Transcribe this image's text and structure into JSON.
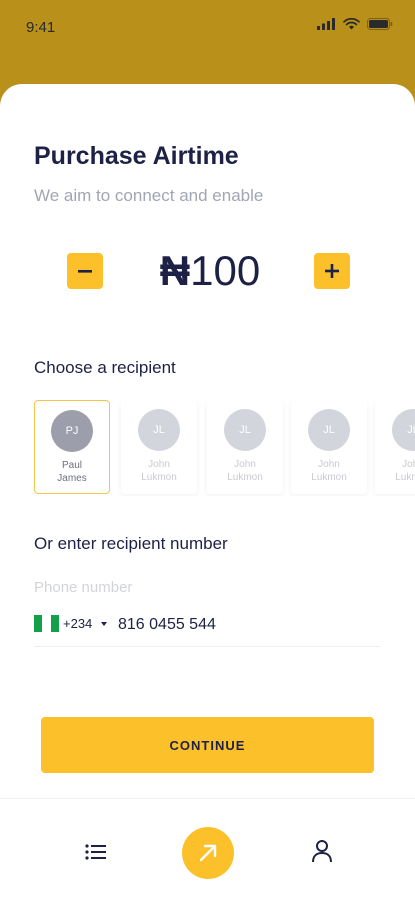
{
  "status_bar": {
    "time": "9:41"
  },
  "page": {
    "title": "Purchase Airtime",
    "subtitle": "We aim to connect and enable"
  },
  "amount": {
    "currency": "₦",
    "value": "100",
    "decrease_icon": "minus-icon",
    "increase_icon": "plus-icon"
  },
  "recipients": {
    "label": "Choose a recipient",
    "items": [
      {
        "initials": "PJ",
        "first": "Paul",
        "last": "James",
        "selected": true
      },
      {
        "initials": "JL",
        "first": "John",
        "last": "Lukmon",
        "selected": false
      },
      {
        "initials": "JL",
        "first": "John",
        "last": "Lukmon",
        "selected": false
      },
      {
        "initials": "JL",
        "first": "John",
        "last": "Lukmon",
        "selected": false
      },
      {
        "initials": "JL",
        "first": "John",
        "last": "Lukmon",
        "selected": false
      }
    ]
  },
  "phone": {
    "label": "Or enter recipient number",
    "placeholder": "Phone number",
    "country_code": "+234",
    "value": "816 0455 544",
    "flag": "nigeria-flag-icon"
  },
  "continue_label": "CONTINUE",
  "tab_bar": {
    "items": [
      "list-icon",
      "send-arrow-icon",
      "profile-icon"
    ]
  },
  "colors": {
    "header_bg": "#B8901A",
    "accent": "#FCC02A",
    "text_primary": "#1C2145",
    "text_muted": "#A2A5B5"
  }
}
